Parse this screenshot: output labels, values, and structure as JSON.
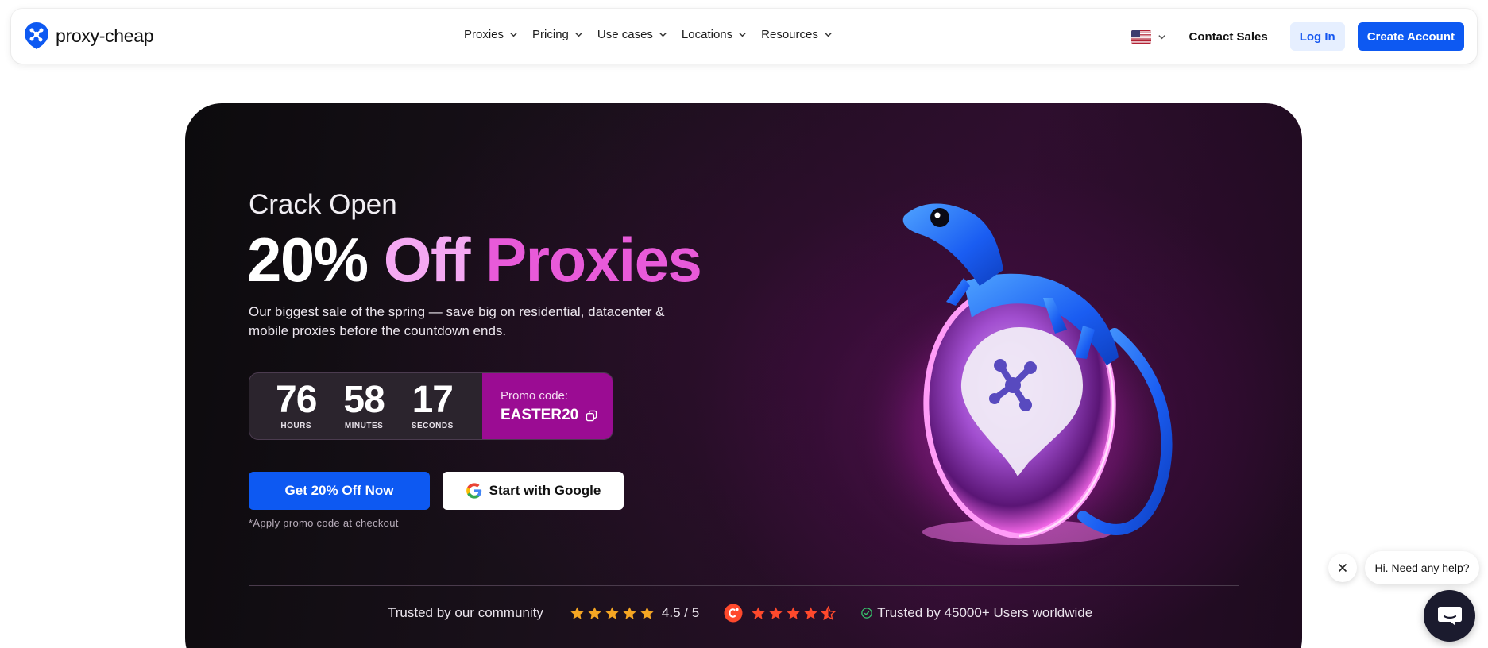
{
  "brand": {
    "name": "proxy-cheap"
  },
  "nav": {
    "items": [
      {
        "label": "Proxies"
      },
      {
        "label": "Pricing"
      },
      {
        "label": "Use cases"
      },
      {
        "label": "Locations"
      },
      {
        "label": "Resources"
      }
    ],
    "language_icon": "us-flag-icon",
    "contact_label": "Contact Sales",
    "login_label": "Log In",
    "create_label": "Create Account"
  },
  "hero": {
    "subtitle": "Crack Open",
    "title_part1": "20%",
    "title_part2": "Off",
    "title_part3": "Proxies",
    "description": "Our biggest sale of the spring — save big on residential, datacenter & mobile proxies before the countdown ends.",
    "countdown": {
      "hours": "76",
      "hours_label": "HOURS",
      "minutes": "58",
      "minutes_label": "MINUTES",
      "seconds": "17",
      "seconds_label": "SECONDS"
    },
    "promo": {
      "label": "Promo code:",
      "code": "EASTER20"
    },
    "cta_primary": "Get 20% Off Now",
    "cta_google": "Start with Google",
    "note": "*Apply promo code at checkout"
  },
  "trust": {
    "community_text": "Trusted by our community",
    "rating": "4.5 / 5",
    "users_text": "Trusted by 45000+ Users worldwide"
  },
  "chat": {
    "greeting": "Hi. Need any help?"
  },
  "colors": {
    "primary": "#0d59f2",
    "promo_bg": "#9b0c93",
    "title_pink_light": "#f4a8f2",
    "title_pink": "#e85ad9",
    "star_orange": "#f5a623",
    "star_red": "#ff492c"
  }
}
